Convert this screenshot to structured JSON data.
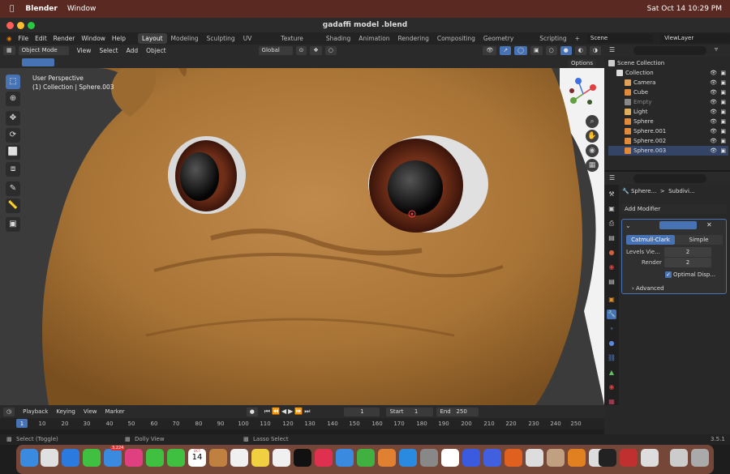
{
  "macos_menubar": {
    "app_name": "Blender",
    "menu_items": [
      "Window"
    ],
    "clock": "Sat Oct 14  10:29 PM"
  },
  "window": {
    "title": "gadaffi model .blend"
  },
  "topbar": {
    "menus": [
      "File",
      "Edit",
      "Render",
      "Window",
      "Help"
    ],
    "workspaces": [
      "Layout",
      "Modeling",
      "Sculpting",
      "UV Editing",
      "Texture Paint",
      "Shading",
      "Animation",
      "Rendering",
      "Compositing",
      "Geometry Nodes",
      "Scripting"
    ],
    "active_workspace": "Layout",
    "scene": "Scene",
    "view_layer": "ViewLayer"
  },
  "viewport_header": {
    "mode": "Object Mode",
    "menus": [
      "View",
      "Select",
      "Add",
      "Object"
    ],
    "transform_orientation": "Global",
    "options": "Options"
  },
  "viewport": {
    "perspective": "User Perspective",
    "collection_info": "(1) Collection | Sphere.003"
  },
  "outliner": {
    "root": "Scene Collection",
    "collection": "Collection",
    "items": [
      {
        "name": "Camera",
        "color": "#e0a05a"
      },
      {
        "name": "Cube",
        "color": "#e08a3a"
      },
      {
        "name": "Empty",
        "color": "#888888"
      },
      {
        "name": "Light",
        "color": "#e0b05a"
      },
      {
        "name": "Sphere",
        "color": "#e08a3a"
      },
      {
        "name": "Sphere.001",
        "color": "#e08a3a"
      },
      {
        "name": "Sphere.002",
        "color": "#e08a3a"
      },
      {
        "name": "Sphere.003",
        "color": "#e08a3a"
      }
    ]
  },
  "properties": {
    "breadcrumb_object": "Sphere...",
    "breadcrumb_modifier": "Subdivi...",
    "add_modifier": "Add Modifier",
    "modifier": {
      "mode_catmull": "Catmull-Clark",
      "mode_simple": "Simple",
      "levels_label": "Levels Vie...",
      "levels_value": "2",
      "render_label": "Render",
      "render_value": "2",
      "optimal_label": "Optimal Disp...",
      "advanced_label": "Advanced"
    }
  },
  "timeline": {
    "menus": [
      "Playback",
      "Keying",
      "View",
      "Marker"
    ],
    "current_frame": "1",
    "start_label": "Start",
    "start_value": "1",
    "end_label": "End",
    "end_value": "250",
    "ticks": [
      "1",
      "10",
      "20",
      "30",
      "40",
      "50",
      "60",
      "70",
      "80",
      "90",
      "100",
      "110",
      "120",
      "130",
      "140",
      "150",
      "160",
      "170",
      "180",
      "190",
      "200",
      "210",
      "220",
      "230",
      "240",
      "250"
    ]
  },
  "statusbar": {
    "left": "Select (Toggle)",
    "mid": "Dolly View",
    "right": "Lasso Select",
    "version": "3.5.1"
  },
  "dock_badges": {
    "mail": "3,224",
    "calendar_month": "OCT",
    "calendar_day": "14"
  }
}
